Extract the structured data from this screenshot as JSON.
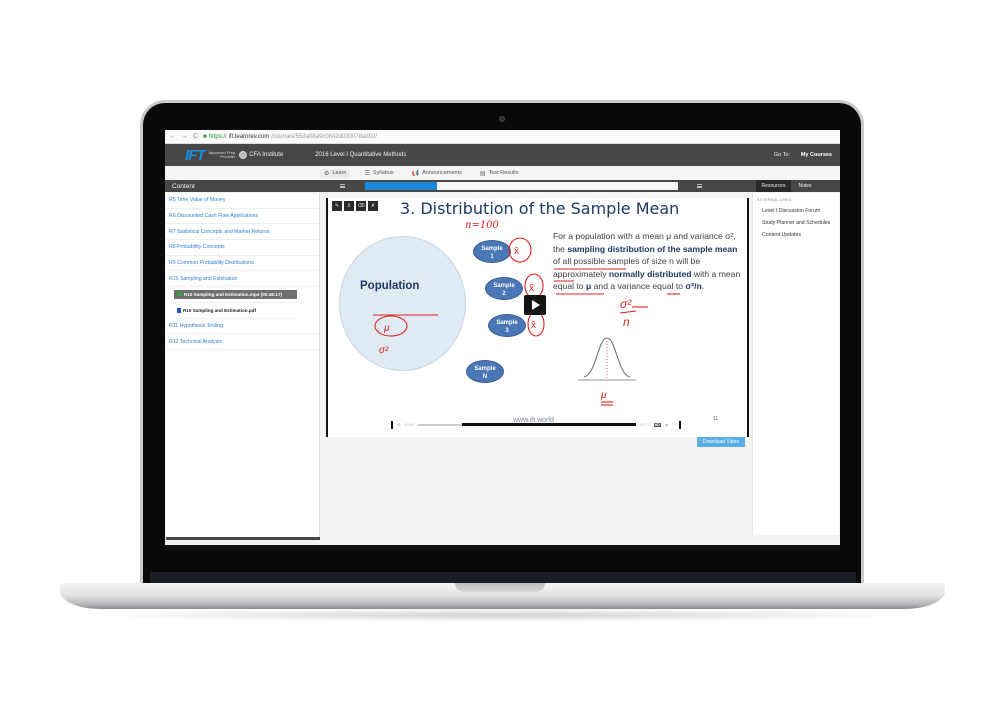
{
  "browser": {
    "back_icon": "back-arrow-icon",
    "forward_icon": "forward-arrow-icon",
    "reload_icon": "reload-icon",
    "url_protocol": "https://",
    "url_host": "ift.learnrev.com",
    "url_path": "/courses/55da08a9c0842d03007dad02/"
  },
  "header": {
    "logo_text": "IFT",
    "logo_sub_line1": "Approved Prep",
    "logo_sub_line2": "Provider",
    "cfa_label": "CFA Institute",
    "course_title": "2016 Level I Quantitative Methods",
    "goto_label": "Go To:",
    "my_courses_label": "My Courses"
  },
  "tabs": [
    {
      "label": "Learn",
      "icon": "learn-icon",
      "active": true
    },
    {
      "label": "Syllabus",
      "icon": "list-icon",
      "active": false
    },
    {
      "label": "Announcements",
      "icon": "megaphone-icon",
      "active": false
    },
    {
      "label": "Test Results",
      "icon": "chart-icon",
      "active": false
    }
  ],
  "toolbar": {
    "content_label": "Content",
    "progress_fraction": 0.23,
    "resources_tab": "Resources",
    "notes_tab": "Notes",
    "colors": {
      "progress": "#1c87d6",
      "header": "#474747"
    }
  },
  "sidebar": {
    "items": [
      {
        "label": "R5 Time Value of Money"
      },
      {
        "label": "R6 Discounted Cash Flow Applications"
      },
      {
        "label": "R7 Statistical Concepts and Market Returns"
      },
      {
        "label": "R8 Probability Concepts"
      },
      {
        "label": "R9 Common Probability Distributions"
      },
      {
        "label": "R10 Sampling and Estimation"
      }
    ],
    "subitems": [
      {
        "label": "R10 Sampling and Estimation.mp4 (00:49:17)",
        "type": "video",
        "active": true
      },
      {
        "label": "R10 Sampling and Estimation.pdf",
        "type": "pdf",
        "active": false
      }
    ],
    "items_after": [
      {
        "label": "R11 Hypothesis Testing"
      },
      {
        "label": "R12 Technical Analysis"
      }
    ]
  },
  "video": {
    "tools": [
      "pen-tool-icon",
      "marker-tool-icon",
      "eraser-tool-icon",
      "clear-tool-icon"
    ],
    "slide_title": "3. Distribution of the Sample Mean",
    "population_label": "Population",
    "samples": [
      {
        "line1": "Sample",
        "line2": "1"
      },
      {
        "line1": "Sample",
        "line2": "2"
      },
      {
        "line1": "Sample",
        "line2": "3"
      },
      {
        "line1": "Sample",
        "line2": "N"
      }
    ],
    "text_parts": {
      "p1": "For a population with a mean μ and variance σ², the ",
      "b1": "sampling distribution of the sample mean",
      "p2": " of all possible samples of size n will be approximately ",
      "b2": "normally distributed",
      "p3": " with a mean equal to ",
      "b3": "μ",
      "p4": " and a variance equal to ",
      "b4": "σ²/n",
      "p5": "."
    },
    "annotation_n": "n=100",
    "watermark": "www.ift.world",
    "page_number": "11",
    "time_current": "10:00",
    "time_total": "49:17",
    "hd_label": "HD",
    "played_fraction": 0.2
  },
  "download_button": "Download Video",
  "resources": {
    "section_label": "EXTERNAL LINKS",
    "links": [
      "Level I Discussion Forum",
      "Study Planner and Schedules",
      "Content Updates"
    ]
  }
}
